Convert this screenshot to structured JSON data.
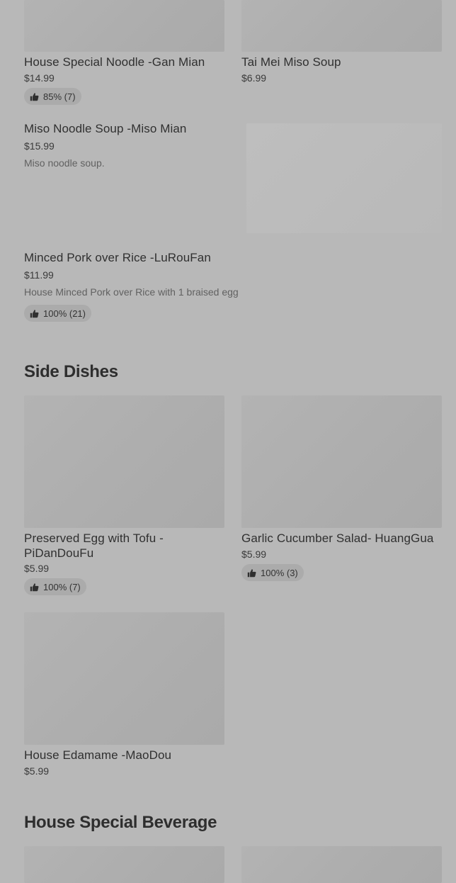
{
  "menu": {
    "top_items": [
      {
        "name": "House Special Noodle -Gan Mian",
        "price": "$14.99",
        "rating": "85% (7)"
      },
      {
        "name": "Tai Mei Miso Soup",
        "price": "$6.99"
      },
      {
        "name": "Miso Noodle Soup -Miso Mian",
        "price": "$15.99",
        "description": "Miso noodle soup."
      },
      {
        "name": "Minced Pork over Rice -LuRouFan",
        "price": "$11.99",
        "description": "House Minced Pork over Rice with 1 braised egg",
        "rating": "100% (21)"
      }
    ],
    "side_dishes": {
      "title": "Side Dishes",
      "items": [
        {
          "name": "Preserved Egg with Tofu -PiDanDouFu",
          "price": "$5.99",
          "rating": "100% (7)"
        },
        {
          "name": "Garlic Cucumber Salad- HuangGua",
          "price": "$5.99",
          "rating": "100% (3)"
        },
        {
          "name": "House Edamame -MaoDou",
          "price": "$5.99"
        }
      ]
    },
    "beverages": {
      "title": "House Special Beverage"
    }
  },
  "icons": {
    "rating": "thumbs-up-icon"
  },
  "colors": {
    "overlay_background": "#b8b8b8",
    "image_placeholder": "#adadad",
    "rating_pill": "#ababab",
    "text_primary": "#2f2f2f",
    "text_secondary": "#616161"
  }
}
